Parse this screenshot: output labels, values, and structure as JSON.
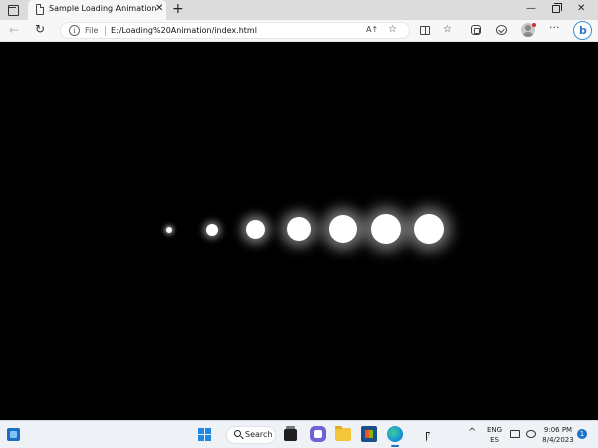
{
  "browser": {
    "tab": {
      "title": "Sample Loading Animation",
      "close_glyph": "✕"
    },
    "new_tab_glyph": "+",
    "window": {
      "minimize_glyph": "—",
      "close_glyph": "✕"
    },
    "toolbar": {
      "back_glyph": "←",
      "refresh_glyph": "↻",
      "address": {
        "info_glyph": "i",
        "scheme_label": "File",
        "url": "E:/Loading%20Animation/index.html"
      },
      "read_aloud_glyph": "A↑",
      "favorite_glyph": "☆",
      "favorites_glyph": "☆",
      "more_glyph": "···",
      "copilot_glyph": "b"
    }
  },
  "page": {
    "background": "#000000",
    "dot_color": "#ffffff",
    "dots_count": 7
  },
  "taskbar": {
    "search_label": "Search",
    "chevron_glyph": "^",
    "language": [
      "ENG",
      "ES"
    ],
    "clock": {
      "time": "9:06 PM",
      "date": "8/4/2023"
    },
    "notification_count": "1"
  }
}
